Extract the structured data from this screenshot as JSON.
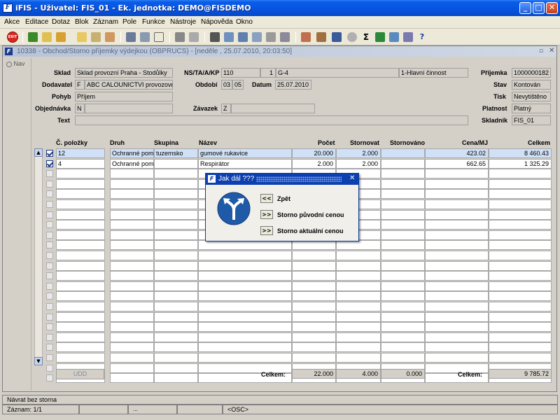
{
  "window": {
    "title": "iFIS - Uživatel: FIS_01 - Ek. jednotka: DEMO@FISDEMO",
    "icon": "F"
  },
  "menu": [
    "Akce",
    "Editace",
    "Dotaz",
    "Blok",
    "Záznam",
    "Pole",
    "Funkce",
    "Nástroje",
    "Nápověda",
    "Okno"
  ],
  "toolbar": {
    "exit_label": "EXIT"
  },
  "form": {
    "title": "10338 - Obchod/Storno příjemky výdejkou (OBPRUCS) - [neděle , 25.07.2010, 20:03:50]",
    "nav_label": "Nav",
    "labels": {
      "sklad": "Sklad",
      "dodavatel": "Dodavatel",
      "pohyb": "Pohyb",
      "objednavka": "Objednávka",
      "text": "Text",
      "nstakp": "NS/TA/A/KP",
      "obdobi": "Období",
      "datum": "Datum",
      "zavazek": "Závazek",
      "prijemka": "Příjemka",
      "stav": "Stav",
      "tisk": "Tisk",
      "platnost": "Platnost",
      "skladnik": "Skladník"
    },
    "values": {
      "sklad": "Sklad provozní Praha - Stodůlky",
      "dodavatel_code": "F",
      "dodavatel_name": "ABC CALOUNICTVI provozovna",
      "pohyb": "Příjem",
      "objednavka_code": "N",
      "objednavka_value": "",
      "text": "",
      "ns": "110",
      "ta": "1",
      "a": "G-4",
      "kp": "1-Hlavní činnost",
      "obdobi_1": "03",
      "obdobi_2": "05",
      "datum": "25.07.2010",
      "zavazek_code": "Z",
      "zavazek_value": "",
      "prijemka": "1000000182",
      "stav": "Kontován",
      "tisk": "Nevytištěno",
      "platnost": "Platný",
      "skladnik": "FIS_01"
    }
  },
  "grid": {
    "columns": [
      "Č. položky",
      "Druh",
      "Skupina",
      "Název",
      "Počet",
      "Stornovat",
      "Stornováno",
      "Cena/MJ",
      "Celkem"
    ],
    "rows": [
      {
        "checked": true,
        "cislo": "12",
        "druh": "Ochranné pomů",
        "skupina": "tuzemsko",
        "nazev": "gumové rukavice",
        "pocet": "20.000",
        "stornovat": "2.000",
        "stornovano": "",
        "cena": "423.02",
        "celkem": "8 460.43"
      },
      {
        "checked": true,
        "cislo": "4",
        "druh": "Ochranné pomů",
        "skupina": "",
        "nazev": "Respirátor",
        "pocet": "2.000",
        "stornovat": "2.000",
        "stornovano": "",
        "cena": "662.65",
        "celkem": "1 325.29"
      }
    ],
    "empty_rows": 21
  },
  "totals": {
    "udd_label": "UDD",
    "celkem_label": "Celkem:",
    "pocet": "22.000",
    "stornovat": "4.000",
    "stornovano": "0.000",
    "celkem_label2": "Celkem:",
    "celkem": "9 785.72"
  },
  "dialog": {
    "title": "Jak dál ???",
    "back_glyph": "<<",
    "back_label": "Zpět",
    "opt1_glyph": ">>",
    "opt1_label": "Storno původní cenou",
    "opt2_glyph": ">>",
    "opt2_label": "Storno aktuální cenou",
    "close": "✕"
  },
  "status": {
    "message": "Návrat bez storna",
    "record": "Záznam: 1/1",
    "seg3": "...",
    "osc": "<OSC>"
  },
  "colors": {
    "title_blue": "#0553e0",
    "selected_row": "#cfe0f7",
    "dialog_title": "#0c3fb0",
    "exit_red": "#d6261d"
  }
}
